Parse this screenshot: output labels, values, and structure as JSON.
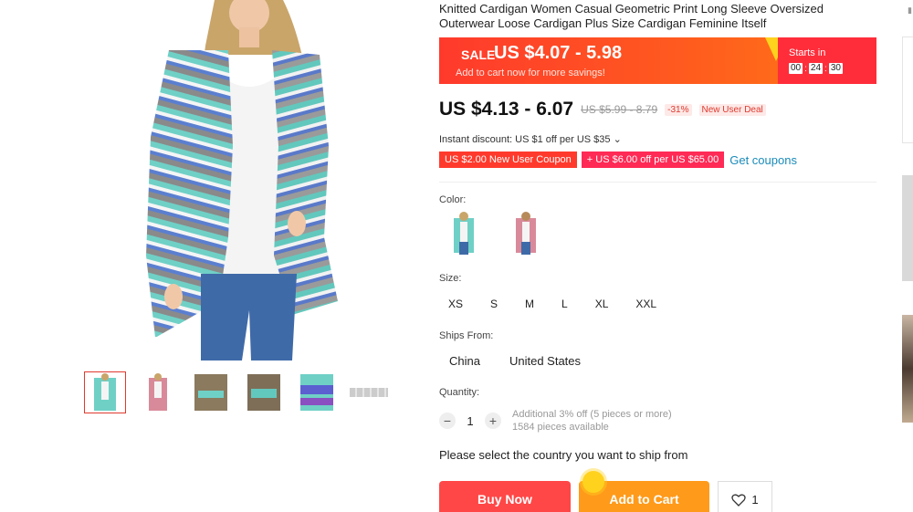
{
  "product": {
    "title": "Knitted Cardigan Women Casual Geometric Print Long Sleeve Oversized Outerwear Loose Cardigan Plus Size Cardigan Feminine Itself"
  },
  "sale": {
    "tag": "SALE",
    "price": "US $4.07 - 5.98",
    "subtext": "Add to cart now for more savings!",
    "starts_label": "Starts in",
    "timer": [
      "00",
      "24",
      "30"
    ]
  },
  "price": {
    "current": "US $4.13 - 6.07",
    "original": "US $5.99 - 8.79",
    "discount": "-31%",
    "deal": "New User Deal"
  },
  "instant_discount": "Instant discount: US $1 off per US $35 ⌄",
  "coupons": {
    "new_user": "US $2.00 New User Coupon",
    "store": "+ US $6.00 off per US $65.00",
    "link": "Get coupons"
  },
  "color": {
    "label": "Color:"
  },
  "size": {
    "label": "Size:",
    "options": [
      "XS",
      "S",
      "M",
      "L",
      "XL",
      "XXL"
    ]
  },
  "ships_from": {
    "label": "Ships From:",
    "options": [
      "China",
      "United States"
    ]
  },
  "quantity": {
    "label": "Quantity:",
    "minus": "−",
    "value": "1",
    "plus": "+",
    "note1": "Additional 3% off (5 pieces or more)",
    "note2": "1584 pieces available"
  },
  "ship_message": "Please select the country you want to ship from",
  "actions": {
    "buy_now": "Buy Now",
    "add_to_cart": "Add to Cart",
    "wishlist_count": "1"
  },
  "colors": {
    "sale_red": "#ff3a2c",
    "sale_orange": "#ff7a14",
    "buy_now": "#ff4747",
    "add_to_cart": "#ff9a1a",
    "link": "#1a8bb9"
  }
}
